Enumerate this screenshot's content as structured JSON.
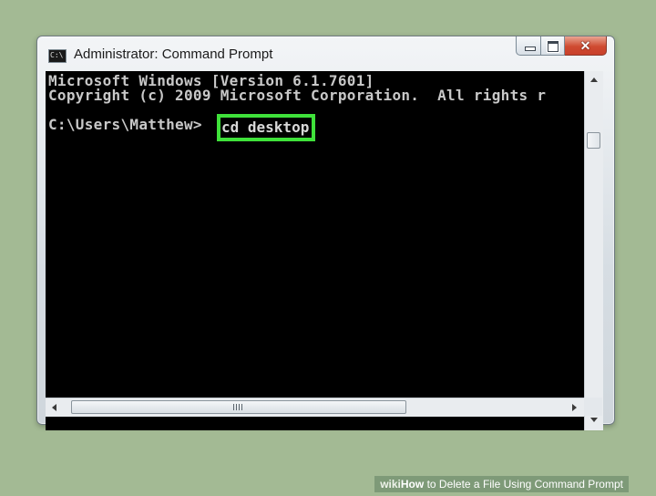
{
  "window": {
    "title": "Administrator: Command Prompt",
    "app_icon": "cmd-icon",
    "app_icon_text": "C:\\",
    "close_glyph": "✕"
  },
  "console": {
    "line1": "Microsoft Windows [Version 6.1.7601]",
    "line2": "Copyright (c) 2009 Microsoft Corporation.  All rights r",
    "prompt": "C:\\Users\\Matthew>",
    "command": "cd desktop",
    "text_color": "#c8c8c8",
    "background_color": "#000000",
    "highlight_color": "#3fe13a"
  },
  "scrollbars": {
    "grip_icon": "scroll-grip-icon"
  },
  "watermark": {
    "wiki": "wiki",
    "how": "How",
    "text": " to Delete a File Using Command Prompt"
  }
}
